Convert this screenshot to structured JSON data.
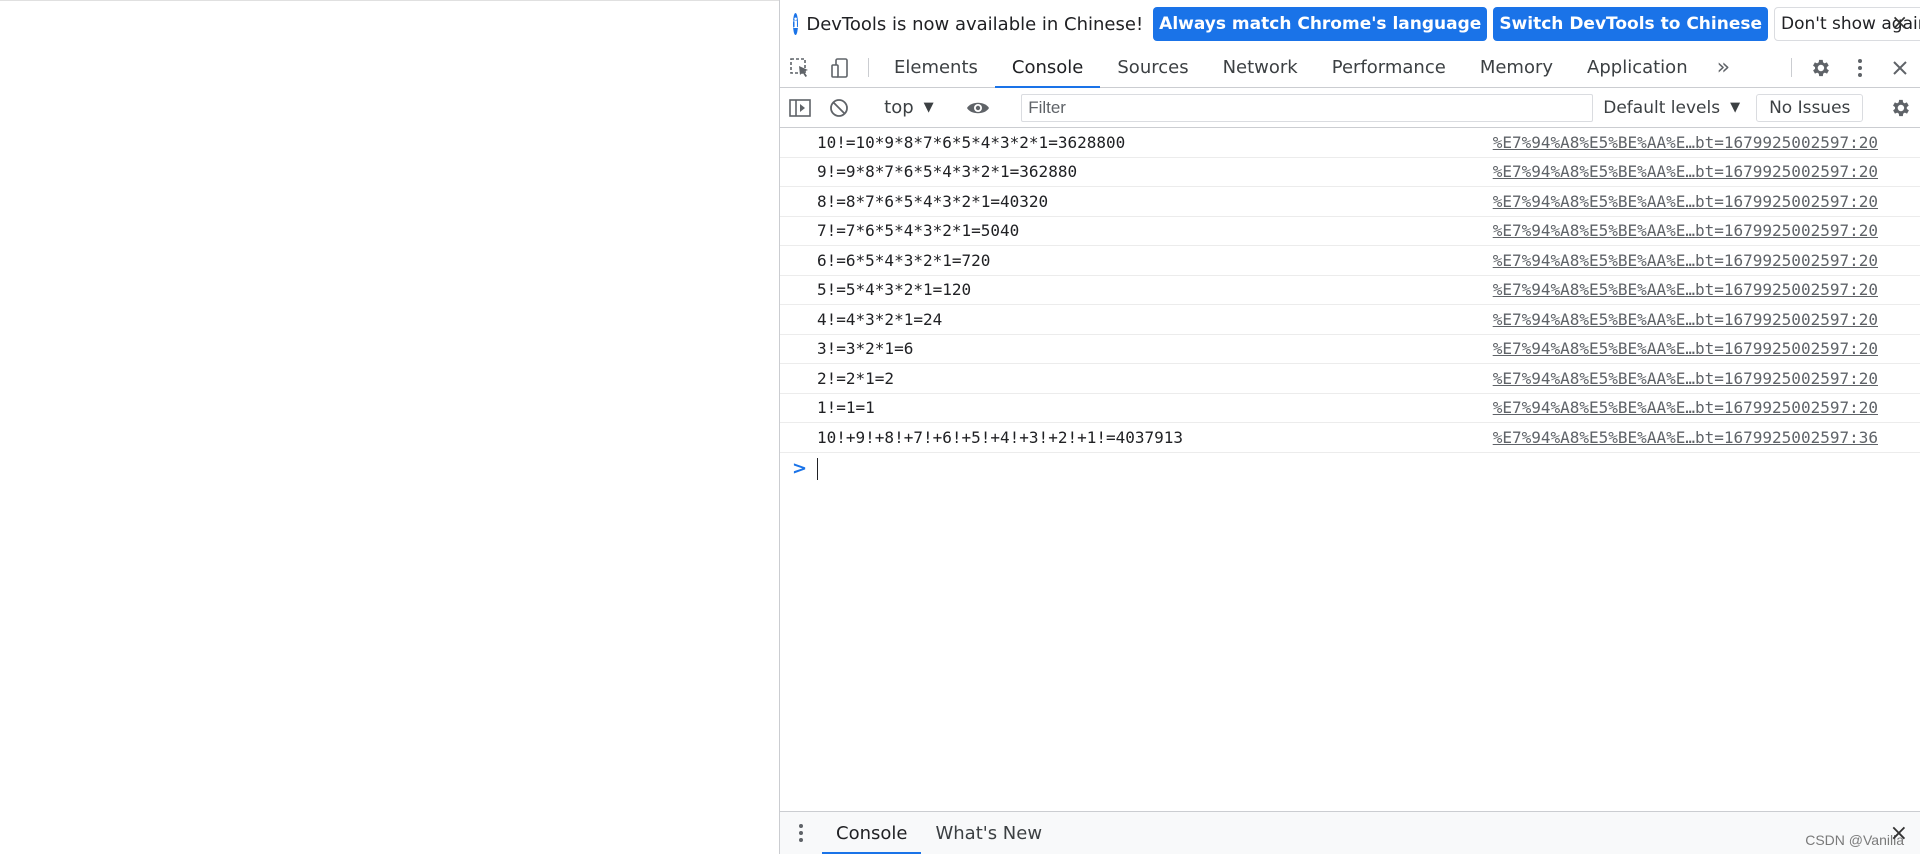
{
  "infobar": {
    "message": "DevTools is now available in Chinese!",
    "btn_match": "Always match Chrome's language",
    "btn_switch": "Switch DevTools to Chinese",
    "btn_dont_show": "Don't show again",
    "close": "×"
  },
  "tabs": {
    "elements": "Elements",
    "console": "Console",
    "sources": "Sources",
    "network": "Network",
    "performance": "Performance",
    "memory": "Memory",
    "application": "Application",
    "more": "»"
  },
  "console_toolbar": {
    "context": "top",
    "filter_placeholder": "Filter",
    "levels": "Default levels",
    "issues": "No Issues"
  },
  "messages": [
    {
      "text": "10!=10*9*8*7*6*5*4*3*2*1=3628800",
      "source": "%E7%94%A8%E5%BE%AA%E…bt=1679925002597:20"
    },
    {
      "text": "9!=9*8*7*6*5*4*3*2*1=362880",
      "source": "%E7%94%A8%E5%BE%AA%E…bt=1679925002597:20"
    },
    {
      "text": "8!=8*7*6*5*4*3*2*1=40320",
      "source": "%E7%94%A8%E5%BE%AA%E…bt=1679925002597:20"
    },
    {
      "text": "7!=7*6*5*4*3*2*1=5040",
      "source": "%E7%94%A8%E5%BE%AA%E…bt=1679925002597:20"
    },
    {
      "text": "6!=6*5*4*3*2*1=720",
      "source": "%E7%94%A8%E5%BE%AA%E…bt=1679925002597:20"
    },
    {
      "text": "5!=5*4*3*2*1=120",
      "source": "%E7%94%A8%E5%BE%AA%E…bt=1679925002597:20"
    },
    {
      "text": "4!=4*3*2*1=24",
      "source": "%E7%94%A8%E5%BE%AA%E…bt=1679925002597:20"
    },
    {
      "text": "3!=3*2*1=6",
      "source": "%E7%94%A8%E5%BE%AA%E…bt=1679925002597:20"
    },
    {
      "text": "2!=2*1=2",
      "source": "%E7%94%A8%E5%BE%AA%E…bt=1679925002597:20"
    },
    {
      "text": "1!=1=1",
      "source": "%E7%94%A8%E5%BE%AA%E…bt=1679925002597:20"
    },
    {
      "text": "10!+9!+8!+7!+6!+5!+4!+3!+2!+1!=4037913",
      "source": "%E7%94%A8%E5%BE%AA%E…bt=1679925002597:36"
    }
  ],
  "prompt": ">",
  "drawer": {
    "tab_console": "Console",
    "tab_whats_new": "What's New",
    "close": "×"
  },
  "watermark": "CSDN @Vanilla"
}
